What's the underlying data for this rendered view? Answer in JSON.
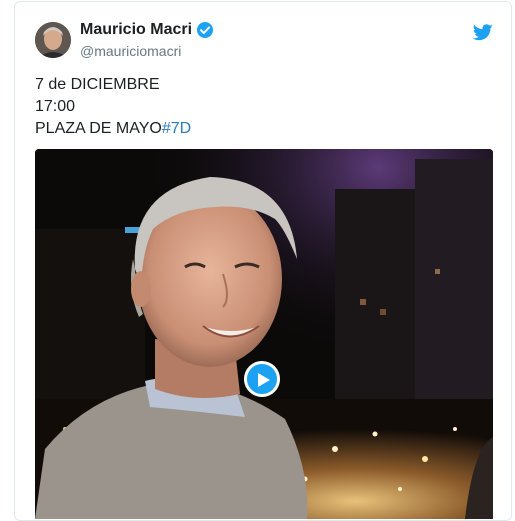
{
  "tweet": {
    "author_name": "Mauricio Macri",
    "author_handle": "@mauriciomacri",
    "text_lines": [
      "7 de DICIEMBRE",
      "17:00",
      "PLAZA DE MAYO"
    ],
    "hashtag": "#7D"
  },
  "icons": {
    "verified": "verified-badge-icon",
    "brand": "twitter-bird-icon",
    "play": "play-icon"
  },
  "colors": {
    "accent": "#1da1f2",
    "hashtag": "#2b7bb9",
    "name": "#1c2022",
    "handle": "#697882",
    "border": "#e1e8ed"
  }
}
